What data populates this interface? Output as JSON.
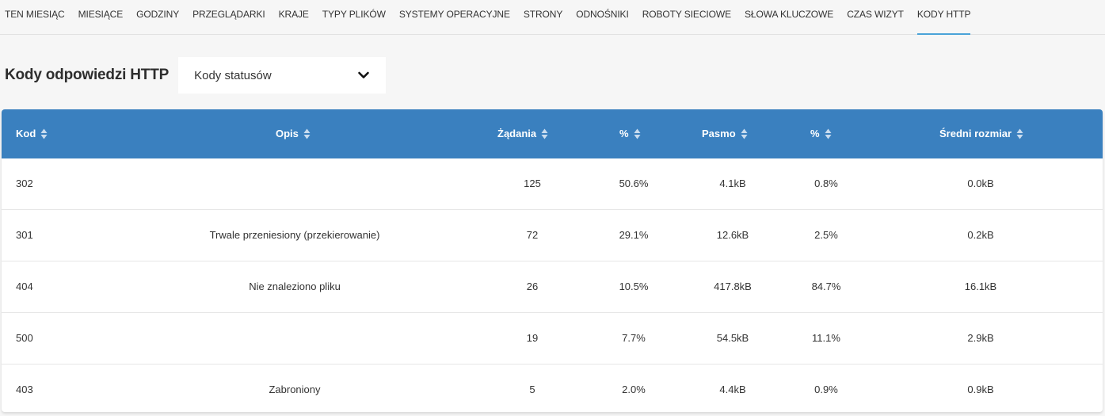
{
  "nav": {
    "items": [
      {
        "label": "TEN MIESIĄC"
      },
      {
        "label": "MIESIĄCE"
      },
      {
        "label": "GODZINY"
      },
      {
        "label": "PRZEGLĄDARKI"
      },
      {
        "label": "KRAJE"
      },
      {
        "label": "TYPY PLIKÓW"
      },
      {
        "label": "SYSTEMY OPERACYJNE"
      },
      {
        "label": "STRONY"
      },
      {
        "label": "ODNOŚNIKI"
      },
      {
        "label": "ROBOTY SIECIOWE"
      },
      {
        "label": "SŁOWA KLUCZOWE"
      },
      {
        "label": "CZAS WIZYT"
      },
      {
        "label": "KODY HTTP"
      }
    ],
    "active": "KODY HTTP"
  },
  "page": {
    "title": "Kody odpowiedzi HTTP",
    "select_value": "Kody statusów",
    "select_icon": "chevron-down-icon"
  },
  "table": {
    "header_color": "#3a80bf",
    "columns": [
      {
        "label": "Kod"
      },
      {
        "label": "Opis"
      },
      {
        "label": "Żądania"
      },
      {
        "label": "%"
      },
      {
        "label": "Pasmo"
      },
      {
        "label": "%"
      },
      {
        "label": "Średni rozmiar"
      }
    ],
    "rows": [
      {
        "kod": "302",
        "opis": "",
        "zadania": "125",
        "proc_zadania": "50.6%",
        "pasmo": "4.1kB",
        "proc_pasmo": "0.8%",
        "sredni": "0.0kB"
      },
      {
        "kod": "301",
        "opis": "Trwale przeniesiony (przekierowanie)",
        "zadania": "72",
        "proc_zadania": "29.1%",
        "pasmo": "12.6kB",
        "proc_pasmo": "2.5%",
        "sredni": "0.2kB"
      },
      {
        "kod": "404",
        "opis": "Nie znaleziono pliku",
        "zadania": "26",
        "proc_zadania": "10.5%",
        "pasmo": "417.8kB",
        "proc_pasmo": "84.7%",
        "sredni": "16.1kB"
      },
      {
        "kod": "500",
        "opis": "",
        "zadania": "19",
        "proc_zadania": "7.7%",
        "pasmo": "54.5kB",
        "proc_pasmo": "11.1%",
        "sredni": "2.9kB"
      },
      {
        "kod": "403",
        "opis": "Zabroniony",
        "zadania": "5",
        "proc_zadania": "2.0%",
        "pasmo": "4.4kB",
        "proc_pasmo": "0.9%",
        "sredni": "0.9kB"
      }
    ]
  }
}
